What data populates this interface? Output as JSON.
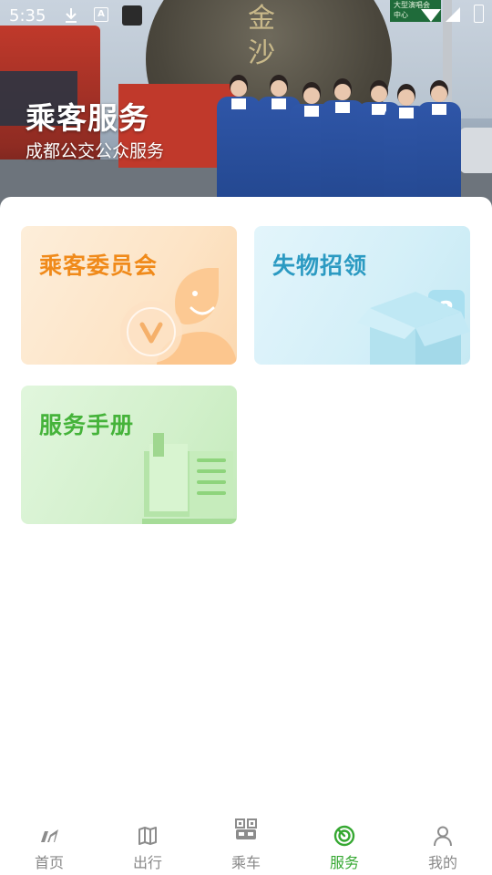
{
  "status_bar": {
    "time": "5:35",
    "icons": [
      "download-icon",
      "a-badge-icon",
      "app-square-icon",
      "wifi-icon",
      "signal-icon",
      "battery-charging-icon"
    ],
    "a_badge": "A"
  },
  "hero": {
    "title": "乘客服务",
    "subtitle": "成都公交公众服务",
    "sculpture_text": "金沙",
    "sign_text": "大型演唱会 中心"
  },
  "cards": [
    {
      "label": "乘客委员会",
      "icon": "committee-person-icon",
      "color": "#f08a1a"
    },
    {
      "label": "失物招领",
      "icon": "lost-box-icon",
      "color": "#2b9ac2"
    },
    {
      "label": "服务手册",
      "icon": "handbook-book-icon",
      "color": "#45b33a"
    }
  ],
  "bottom_nav": {
    "items": [
      {
        "label": "首页",
        "icon": "home-icon"
      },
      {
        "label": "出行",
        "icon": "map-icon"
      },
      {
        "label": "乘车",
        "icon": "qr-bus-icon"
      },
      {
        "label": "服务",
        "icon": "service-icon"
      },
      {
        "label": "我的",
        "icon": "profile-icon"
      }
    ],
    "active": "服务",
    "active_color": "#36a832",
    "inactive_color": "#888888"
  }
}
